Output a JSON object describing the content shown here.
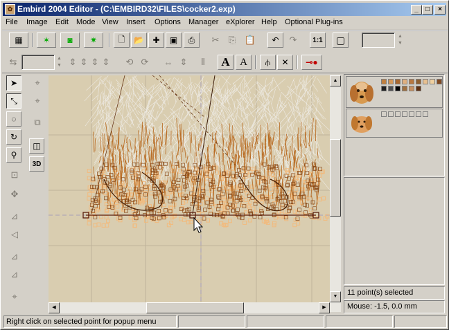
{
  "window": {
    "title": "Embird 2004 Editor - (C:\\EMBIRD32\\FILES\\cocker2.exp)",
    "app_icon": "embird-app-icon",
    "caption_buttons": [
      "minimize",
      "maximize",
      "close"
    ]
  },
  "menu": [
    "File",
    "Image",
    "Edit",
    "Mode",
    "View",
    "Insert",
    "Options",
    "Manager",
    "eXplorer",
    "Help",
    "Optional Plug-ins"
  ],
  "toolbar1": {
    "zoom_ratio_label": "1:1",
    "zoom_field_value": ""
  },
  "toolbar2": {
    "size_field_value": "",
    "text_tool_label": "A",
    "text2_tool_label": "A",
    "icons": [
      "rotate-left-icon",
      "rotate-right-icon",
      "flip-icon",
      "flip-vertical-icon",
      "align-left-icon",
      "align-right-icon",
      "arrange-icon",
      "distribute-icon",
      "text-icon",
      "text-path-icon",
      "split-icon",
      "delete-icon",
      "key-icon"
    ]
  },
  "left_tools": {
    "mode_3d_label": "3D",
    "icons": [
      "arrow-select-icon",
      "lasso-icon",
      "freehand-select-icon",
      "rotate-icon",
      "zoom-icon",
      "node-edit-icon",
      "copy-frame-icon",
      "move-icon",
      "mirror-h-icon",
      "mirror-v-icon",
      "skew-icon",
      "transform-icon",
      "center-icon"
    ]
  },
  "canvas": {
    "background": "#d9cdb0",
    "stitch_light": "#f0eeea",
    "stitch_brown": "#b86a20",
    "stitch_peach": "#f5b978",
    "selection_line": "#5a1e0e"
  },
  "colors_panel": {
    "design1_swatches": [
      "#c08040",
      "#d49858",
      "#a86830",
      "#e0b080",
      "#b87840",
      "#906030",
      "#e8c090",
      "#f0d0a0",
      "#804820",
      "#202020",
      "#505050",
      "#000000",
      "#a07040",
      "#c89060",
      "#603010"
    ],
    "design2_swatches": [
      "#d4d0c8",
      "#d4d0c8",
      "#d4d0c8",
      "#d4d0c8",
      "#d4d0c8",
      "#d4d0c8",
      "#d4d0c8"
    ]
  },
  "info_panel": {
    "points_selected": "11 point(s) selected",
    "mouse_position": "Mouse: -1.5, 0.0 mm"
  },
  "statusbar": {
    "hint": "Right click on selected point for popup menu",
    "pane2": "",
    "pane3": "",
    "pane4": "",
    "pane5": ""
  }
}
